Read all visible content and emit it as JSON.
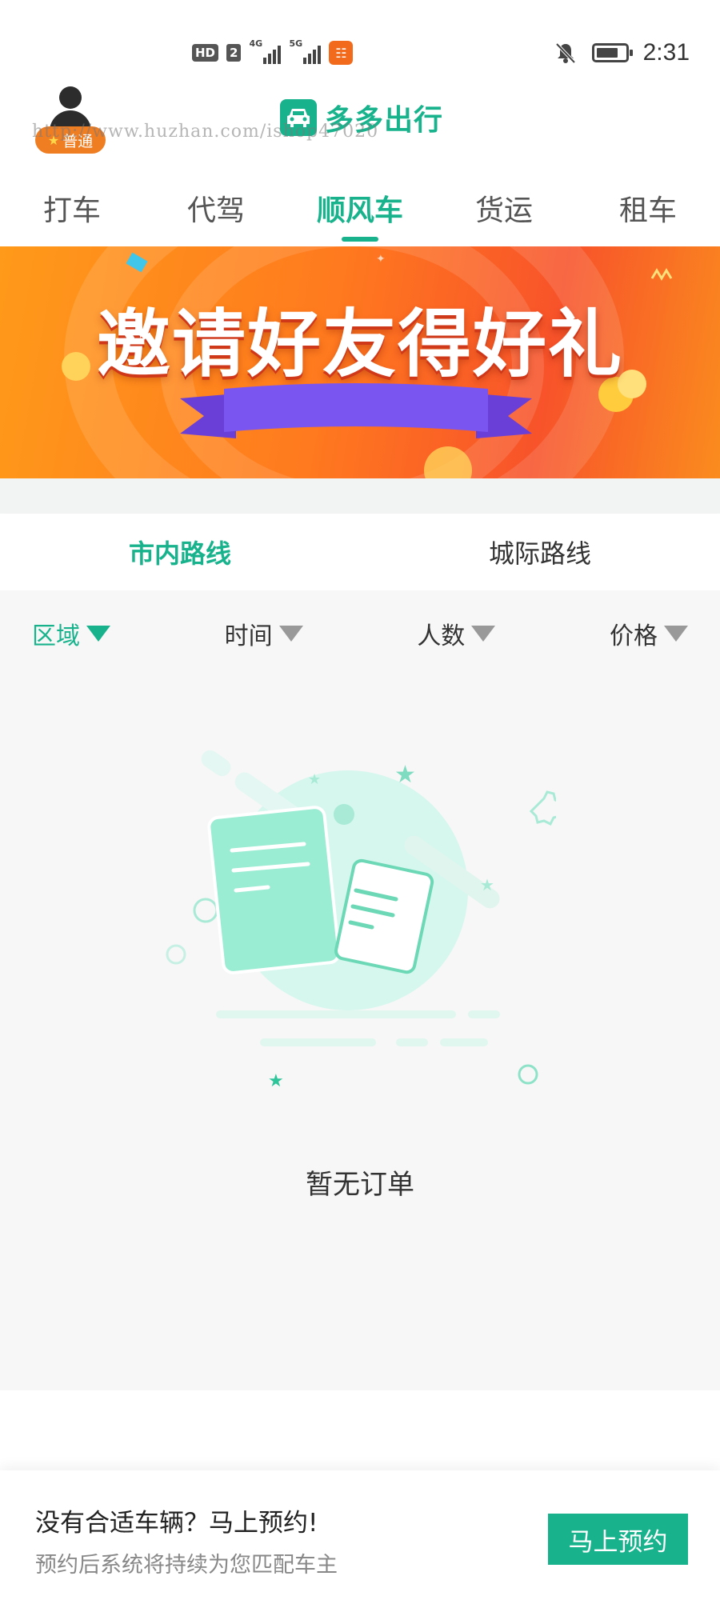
{
  "status_bar": {
    "hd_label": "HD",
    "sim_label": "2",
    "net1": "4G",
    "net2": "5G",
    "time": "2:31"
  },
  "header": {
    "level_label": "普通",
    "app_name": "多多出行",
    "watermark": "http://www.huzhan.com/ishop47020"
  },
  "tabs": [
    {
      "label": "打车",
      "active": false
    },
    {
      "label": "代驾",
      "active": false
    },
    {
      "label": "顺风车",
      "active": true
    },
    {
      "label": "货运",
      "active": false
    },
    {
      "label": "租车",
      "active": false
    }
  ],
  "banner": {
    "title": "邀请好友得好礼"
  },
  "route_tabs": [
    {
      "label": "市内路线",
      "active": true
    },
    {
      "label": "城际路线",
      "active": false
    }
  ],
  "filters": [
    {
      "label": "区域",
      "active": true
    },
    {
      "label": "时间",
      "active": false
    },
    {
      "label": "人数",
      "active": false
    },
    {
      "label": "价格",
      "active": false
    }
  ],
  "empty_state": {
    "message": "暂无订单"
  },
  "bottom": {
    "title": "没有合适车辆？马上预约!",
    "subtitle": "预约后系统将持续为您匹配车主",
    "button_label": "马上预约"
  },
  "colors": {
    "accent": "#18b38c",
    "badge": "#ef7d22"
  }
}
